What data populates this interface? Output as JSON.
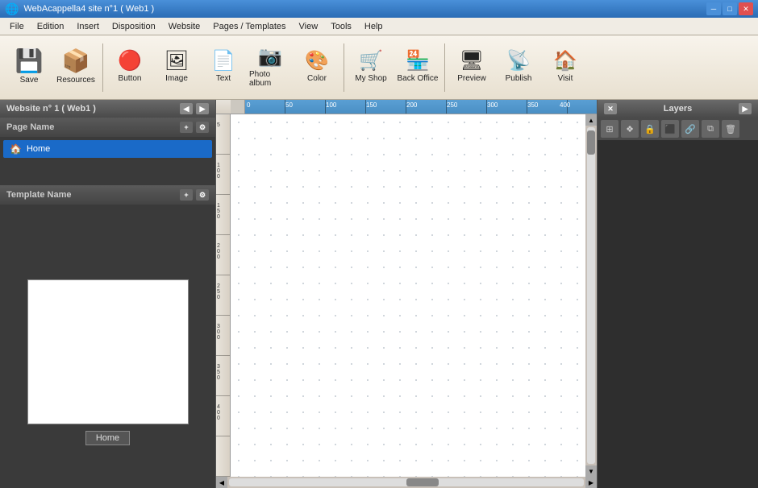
{
  "titlebar": {
    "title": "WebAcappella4 site n°1 ( Web1 )",
    "icon": "🌐"
  },
  "menubar": {
    "items": [
      "File",
      "Edition",
      "Insert",
      "Disposition",
      "Website",
      "Pages / Templates",
      "View",
      "Tools",
      "Help"
    ]
  },
  "toolbar": {
    "buttons": [
      {
        "id": "save",
        "label": "Save",
        "icon": "💾"
      },
      {
        "id": "resources",
        "label": "Resources",
        "icon": "📦"
      },
      {
        "id": "button",
        "label": "Button",
        "icon": "🔴"
      },
      {
        "id": "image",
        "label": "Image",
        "icon": "🖼"
      },
      {
        "id": "text",
        "label": "Text",
        "icon": "📄"
      },
      {
        "id": "photo-album",
        "label": "Photo album",
        "icon": "📷"
      },
      {
        "id": "color",
        "label": "Color",
        "icon": "🎨"
      },
      {
        "id": "my-shop",
        "label": "My Shop",
        "icon": "🛒"
      },
      {
        "id": "back-office",
        "label": "Back Office",
        "icon": "🏪"
      },
      {
        "id": "preview",
        "label": "Preview",
        "icon": "🖥"
      },
      {
        "id": "publish",
        "label": "Publish",
        "icon": "📡"
      },
      {
        "id": "visit",
        "label": "Visit",
        "icon": "🏠"
      }
    ]
  },
  "left_panel": {
    "title": "Website n° 1 ( Web1 )",
    "page_name_label": "Page Name",
    "template_name_label": "Template Name",
    "pages": [
      {
        "name": "Home",
        "active": true
      }
    ],
    "templates": [],
    "preview_label": "Home"
  },
  "canvas": {
    "ruler_numbers": [
      "0",
      "50",
      "100",
      "150",
      "200",
      "250",
      "300",
      "350",
      "400"
    ]
  },
  "right_panel": {
    "title": "Layers",
    "layer_buttons": [
      "⊞",
      "❖",
      "🔒",
      "⬛",
      "🔗",
      "❖",
      "🗑"
    ]
  }
}
